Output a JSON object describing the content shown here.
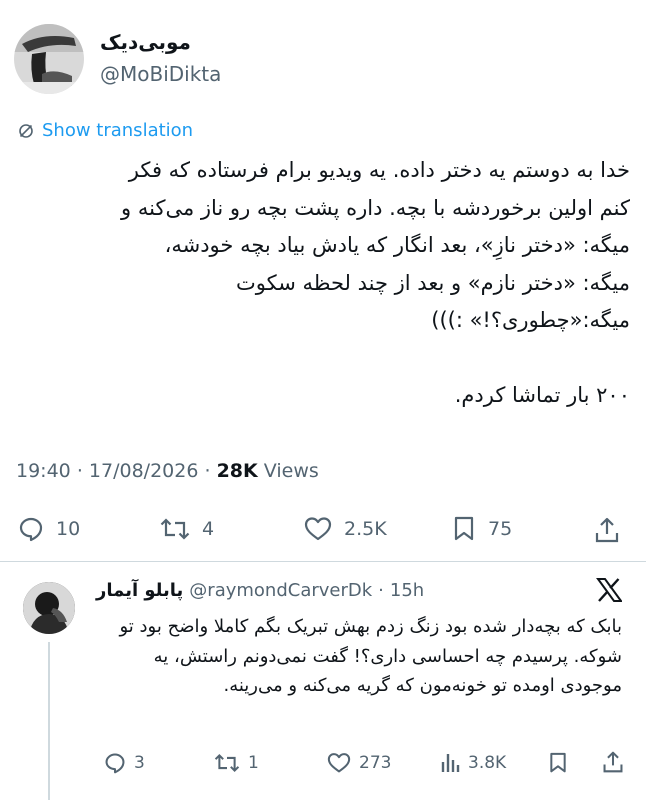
{
  "tweet": {
    "author_name": "موبی‌دیک",
    "author_handle": "@MoBiDikta",
    "translate_label": "Show translation",
    "body": "خدا به دوستم یه دختر داده. یه ویدیو برام فرستاده که فکر\nکنم اولین برخوردشه با بچه. داره پشت بچه رو ناز می‌کنه و\nمیگه: «دختر نازِ»، بعد انگار که یادش بیاد بچه خودشه،\nمیگه: «دختر نازم» و بعد از چند لحظه سکوت\nمیگه:«چطوری؟!» :)))\n\n۲۰۰ بار تماشا کردم.",
    "time": "19:40",
    "date": "17/08/2026",
    "views_count": "28K",
    "views_label": "Views",
    "actions": {
      "replies": "10",
      "retweets": "4",
      "likes": "2.5K",
      "bookmarks": "75"
    }
  },
  "reply": {
    "author_name": "پابلو آیمار",
    "author_handle": "@raymondCarverDk",
    "time": "15h",
    "body": "بابک که بچه‌دار شده بود زنگ زدم بهش تبریک بگم کاملا واضح بود تو شوکه. پرسیدم چه احساسی داری؟! گفت نمی‌دونم راستش، یه موجودی اومده تو خونه‌مون که گریه می‌کنه و می‌رینه.",
    "actions": {
      "replies": "3",
      "retweets": "1",
      "likes": "273",
      "views": "3.8K"
    }
  }
}
